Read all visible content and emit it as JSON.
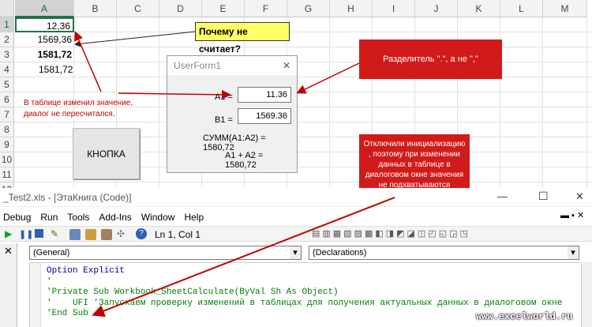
{
  "sheet": {
    "columns": [
      "A",
      "B",
      "C",
      "D",
      "E",
      "F",
      "G",
      "H",
      "I",
      "J",
      "K",
      "L",
      "M"
    ],
    "rows": [
      "1",
      "2",
      "3",
      "4",
      "5",
      "6",
      "7",
      "8",
      "9",
      "10",
      "11",
      "12"
    ],
    "cells": [
      {
        "value": "12,36",
        "bold": false
      },
      {
        "value": "1569,36",
        "bold": false
      },
      {
        "value": "1581,72",
        "bold": true
      },
      {
        "value": "1581,72",
        "bold": false
      }
    ],
    "button_label": "КНОПКА",
    "note_left": "В таблице изменил значение, диалог не пересчитался.",
    "note_top": "Почему не считает?"
  },
  "userform": {
    "title": "UserForm1",
    "close_glyph": "✕",
    "a1_label": "A1 =",
    "a1_value": "11.36",
    "b1_label": "B1 =",
    "b1_value": "1569.36",
    "sum_text": "СУММ(A1:A2) = 1580,72",
    "add_text": "A1 + A2 = 1580,72"
  },
  "callouts": {
    "separator": "Разделитель \".\", а не \",\"",
    "init": "Отключили инициализацию , поэтому при изменении данных в таблице в диалоговом окне значения не подхватываются"
  },
  "vbe": {
    "title": "_Test2.xls - [ЭтаКнига (Code)]",
    "window_controls": [
      "—",
      "☐",
      "✕"
    ],
    "menu": [
      "Debug",
      "Run",
      "Tools",
      "Add-Ins",
      "Window",
      "Help"
    ],
    "position": "Ln 1, Col 1",
    "object_combo": "(General)",
    "proc_combo": "(Declarations)",
    "code_lines": [
      "Option Explicit",
      "'",
      "'Private Sub Workbook_SheetCalculate(ByVal Sh As Object)",
      "'    UFI 'Запускаем проверку изменений в таблицах для получения актуальных данных в диалоговом окне",
      "'End Sub"
    ],
    "close_x": "✕"
  },
  "watermark": "www.excelworld.ru",
  "colors": {
    "accent_green": "#217346",
    "callout_red": "#d11a1a",
    "annotation_red": "#c00000",
    "note_yellow": "#ffff66"
  }
}
